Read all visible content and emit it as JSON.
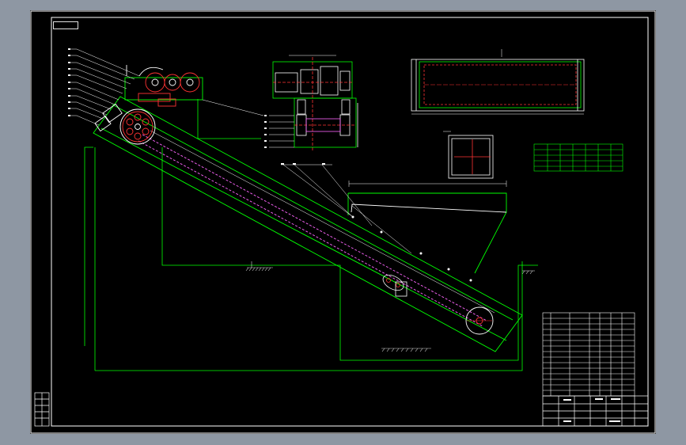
{
  "drawing": {
    "frame_tag": "",
    "tech_title": "",
    "notes": [
      "",
      "",
      "",
      "",
      "",
      "",
      "",
      "",
      "",
      "",
      "",
      "",
      ""
    ],
    "colors": {
      "background": "#000000",
      "outer_margin": "#8e97a3",
      "frame": "#ffffff",
      "outline": "#00ff00",
      "hidden_line": "#ff00ff",
      "center_line": "#ff2020",
      "dimension": "#ffffff",
      "notes_text": "#00ff00"
    }
  }
}
